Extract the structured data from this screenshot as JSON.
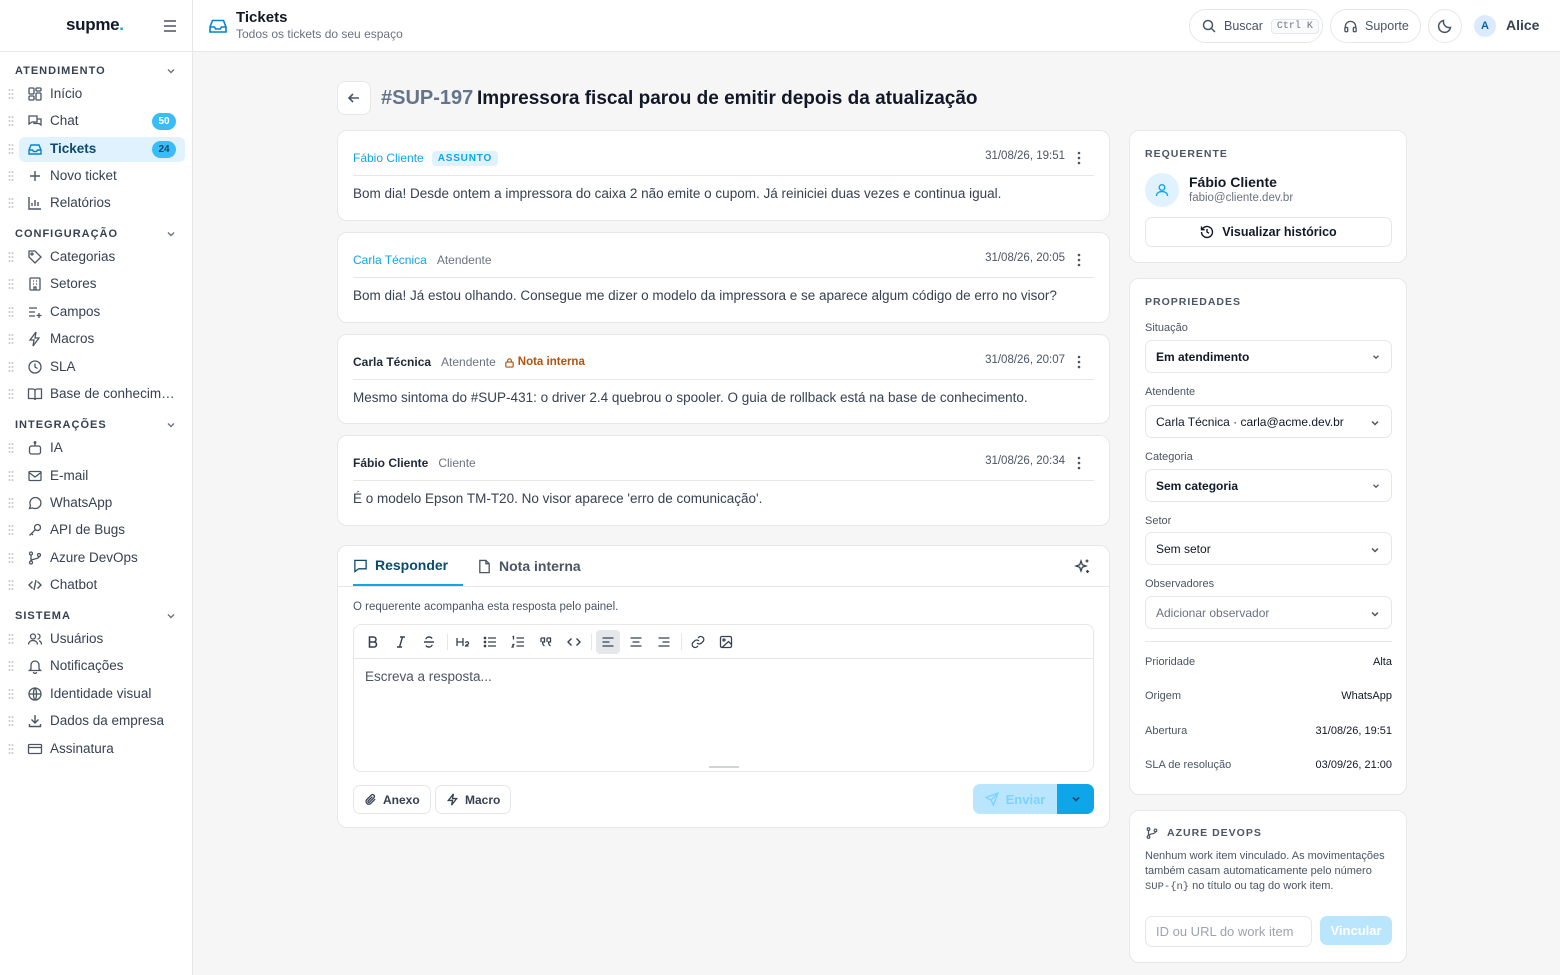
{
  "app": {
    "logo_text": "supme",
    "logo_dot": "."
  },
  "sidebar": {
    "sections": [
      {
        "title": "ATENDIMENTO",
        "items": [
          {
            "label": "Início",
            "icon": "dashboard-icon"
          },
          {
            "label": "Chat",
            "icon": "chat-icon",
            "badge": "50"
          },
          {
            "label": "Tickets",
            "icon": "inbox-icon",
            "badge": "24",
            "active": true
          },
          {
            "label": "Novo ticket",
            "icon": "plus-icon"
          },
          {
            "label": "Relatórios",
            "icon": "bar-chart-icon"
          }
        ]
      },
      {
        "title": "CONFIGURAÇÃO",
        "items": [
          {
            "label": "Categorias",
            "icon": "tag-icon"
          },
          {
            "label": "Setores",
            "icon": "building-icon"
          },
          {
            "label": "Campos",
            "icon": "list-plus-icon"
          },
          {
            "label": "Macros",
            "icon": "zap-icon"
          },
          {
            "label": "SLA",
            "icon": "clock-icon"
          },
          {
            "label": "Base de conhecimento",
            "icon": "book-icon"
          }
        ]
      },
      {
        "title": "INTEGRAÇÕES",
        "items": [
          {
            "label": "IA",
            "icon": "bot-icon"
          },
          {
            "label": "E-mail",
            "icon": "mail-icon"
          },
          {
            "label": "WhatsApp",
            "icon": "message-circle-icon"
          },
          {
            "label": "API de Bugs",
            "icon": "key-icon"
          },
          {
            "label": "Azure DevOps",
            "icon": "git-branch-icon"
          },
          {
            "label": "Chatbot",
            "icon": "code-icon"
          }
        ]
      },
      {
        "title": "SISTEMA",
        "items": [
          {
            "label": "Usuários",
            "icon": "users-icon"
          },
          {
            "label": "Notificações",
            "icon": "bell-icon"
          },
          {
            "label": "Identidade visual",
            "icon": "globe-icon"
          },
          {
            "label": "Dados da empresa",
            "icon": "download-icon"
          },
          {
            "label": "Assinatura",
            "icon": "credit-card-icon"
          }
        ]
      }
    ]
  },
  "header": {
    "title": "Tickets",
    "subtitle": "Todos os tickets do seu espaço",
    "search_label": "Buscar",
    "search_shortcut": "Ctrl K",
    "support_label": "Suporte",
    "user_initial": "A",
    "user_name": "Alice"
  },
  "ticket": {
    "id": "#SUP-197",
    "title": "Impressora fiscal parou de emitir depois da atualização",
    "messages": [
      {
        "author": "Fábio Cliente",
        "tag": "ASSUNTO",
        "time": "31/08/26, 19:51",
        "body": "Bom dia! Desde ontem a impressora do caixa 2 não emite o cupom. Já reiniciei duas vezes e continua igual."
      },
      {
        "author": "Carla Técnica",
        "role": "Atendente",
        "time": "31/08/26, 20:05",
        "body": "Bom dia! Já estou olhando. Consegue me dizer o modelo da impressora e se aparece algum código de erro no visor?"
      },
      {
        "author": "Carla Técnica",
        "role": "Atendente",
        "note": "Nota interna",
        "time": "31/08/26, 20:07",
        "body": "Mesmo sintoma do #SUP-431: o driver 2.4 quebrou o spooler. O guia de rollback está na base de conhecimento."
      },
      {
        "author": "Fábio Cliente",
        "role": "Cliente",
        "time": "31/08/26, 20:34",
        "body": "É o modelo Epson TM-T20. No visor aparece 'erro de comunicação'."
      }
    ]
  },
  "reply": {
    "tab_reply": "Responder",
    "tab_note": "Nota interna",
    "note": "O requerente acompanha esta resposta pelo painel.",
    "placeholder": "Escreva a resposta...",
    "attach_label": "Anexo",
    "macro_label": "Macro",
    "send_label": "Enviar"
  },
  "requester": {
    "section_title": "REQUERENTE",
    "name": "Fábio Cliente",
    "email": "fabio@cliente.dev.br",
    "history_label": "Visualizar histórico"
  },
  "properties": {
    "section_title": "PROPRIEDADES",
    "situacao_label": "Situação",
    "situacao": "Em atendimento",
    "atendente_label": "Atendente",
    "atendente": "Carla Técnica · carla@acme.dev.br",
    "categoria_label": "Categoria",
    "categoria": "Sem categoria",
    "setor_label": "Setor",
    "setor": "Sem setor",
    "observadores_label": "Observadores",
    "observadores_placeholder": "Adicionar observador",
    "prioridade_label": "Prioridade",
    "prioridade": "Alta",
    "origem_label": "Origem",
    "origem": "WhatsApp",
    "abertura_label": "Abertura",
    "abertura": "31/08/26, 19:51",
    "sla_label": "SLA de resolução",
    "sla": "03/09/26, 21:00"
  },
  "azure": {
    "section_title": "AZURE DEVOPS",
    "text_before": "Nenhum work item vinculado. As movimentações também casam automaticamente pelo número ",
    "text_code": "SUP-{n}",
    "text_after": " no título ou tag do work item.",
    "input_placeholder": "ID ou URL do work item",
    "link_label": "Vincular"
  },
  "colors": {
    "accent": "#0ea5e9",
    "accent_light": "#e0f2fe",
    "note": "#b45309"
  }
}
